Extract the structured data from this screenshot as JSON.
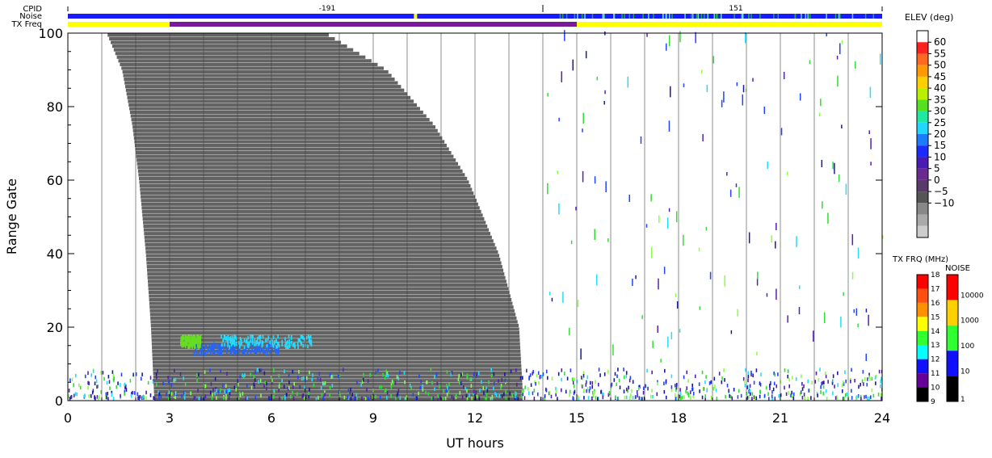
{
  "chart_data": {
    "type": "heatmap",
    "xlabel": "UT hours",
    "ylabel": "Range Gate",
    "xlim": [
      0,
      24
    ],
    "ylim": [
      0,
      100
    ],
    "x_ticks": [
      "0",
      "3",
      "6",
      "9",
      "12",
      "15",
      "18",
      "21",
      "24"
    ],
    "x_minor_step": 1,
    "y_ticks": [
      "0",
      "20",
      "40",
      "60",
      "80",
      "100"
    ],
    "grid": "vertical lines every hour",
    "top_panels": {
      "cpid": {
        "label": "CPID",
        "values": [
          "-191",
          "151"
        ],
        "change_hour": 14.0
      },
      "noise": {
        "label": "Noise",
        "base_color": "#1a1aff",
        "band_color": "#ffff00"
      },
      "tx_freq": {
        "label": "TX Freq",
        "segments": [
          {
            "start": 0,
            "end": 3,
            "color": "#ffff00"
          },
          {
            "start": 3,
            "end": 15,
            "color": "#7a1a9a"
          },
          {
            "start": 15,
            "end": 24,
            "color": "#ffff00"
          }
        ]
      }
    },
    "ground_scatter_region": {
      "color": "#636363",
      "left_boundary": [
        [
          1.15,
          100
        ],
        [
          1.6,
          90
        ],
        [
          1.9,
          75
        ],
        [
          2.1,
          60
        ],
        [
          2.3,
          40
        ],
        [
          2.45,
          20
        ],
        [
          2.55,
          0
        ]
      ],
      "right_boundary": [
        [
          7.6,
          100
        ],
        [
          9.4,
          90
        ],
        [
          10.8,
          75
        ],
        [
          11.8,
          60
        ],
        [
          12.7,
          40
        ],
        [
          13.3,
          20
        ],
        [
          13.4,
          4
        ]
      ]
    },
    "echo_clusters": [
      {
        "x": [
          3.3,
          3.9
        ],
        "y": [
          14,
          17
        ],
        "color": "#66dd22"
      },
      {
        "x": [
          3.6,
          6.2
        ],
        "y": [
          12,
          15
        ],
        "color": "#2266ff"
      },
      {
        "x": [
          4.5,
          7.2
        ],
        "y": [
          14,
          17
        ],
        "color": "#22ddff"
      },
      {
        "x": [
          0.0,
          24.0
        ],
        "y": [
          0,
          8
        ],
        "color": "#2244ff"
      }
    ],
    "elevation_legend": {
      "title": "ELEV (deg)",
      "labels": [
        "60",
        "55",
        "50",
        "45",
        "40",
        "35",
        "30",
        "25",
        "20",
        "15",
        "10",
        "5",
        "0",
        "−5",
        "−10"
      ],
      "colors": [
        "#ffffff",
        "#ff2020",
        "#ff6a20",
        "#ff9a00",
        "#ffd000",
        "#b8f000",
        "#55e020",
        "#20e8a0",
        "#20d8ff",
        "#1c7cff",
        "#1a2cff",
        "#4a1ab4",
        "#6a2a90",
        "#5a3a6a",
        "#555555",
        "#888888",
        "#aaaaaa",
        "#cccccc"
      ]
    },
    "txfreq_legend": {
      "title": "TX FRQ (MHz)",
      "labels": [
        "18",
        "17",
        "16",
        "15",
        "14",
        "13",
        "12",
        "11",
        "10",
        "9"
      ],
      "colors": [
        "#ff0000",
        "#ff5010",
        "#ff9000",
        "#ffff00",
        "#30ff30",
        "#00ffff",
        "#1010ff",
        "#660099",
        "#000000"
      ]
    },
    "noise_legend": {
      "title": "NOISE",
      "labels": [
        "10000",
        "1000",
        "100",
        "10",
        "1"
      ],
      "colors": [
        "#ff0000",
        "#ffd000",
        "#30ff30",
        "#1010ff",
        "#000000"
      ]
    }
  }
}
